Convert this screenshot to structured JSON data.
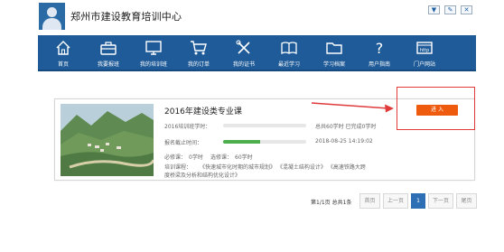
{
  "header": {
    "site_title": "郑州市建设教育培训中心",
    "btn1": "▼",
    "btn2": "✎",
    "btn3": "✕"
  },
  "nav": {
    "items": [
      {
        "label": "首页",
        "icon": "home-icon"
      },
      {
        "label": "我要报班",
        "icon": "briefcase-icon"
      },
      {
        "label": "我的培训班",
        "icon": "monitor-icon"
      },
      {
        "label": "我的订单",
        "icon": "cart-icon"
      },
      {
        "label": "我的证书",
        "icon": "tools-icon"
      },
      {
        "label": "最近学习",
        "icon": "book-icon"
      },
      {
        "label": "学习档案",
        "icon": "folder-icon"
      },
      {
        "label": "用户指南",
        "icon": "question-icon"
      },
      {
        "label": "门户网站",
        "icon": "web-icon"
      }
    ]
  },
  "course": {
    "title": "2016年建设类专业课",
    "study_label": "2016培训班学时：",
    "study_progress_text": "总共60学时 已完成0学时",
    "study_progress": 0,
    "deadline_label": "报名截止时间：",
    "deadline_value": "2018-08-25 14:19:02",
    "deadline_progress": 0.45,
    "required_label": "必修课：",
    "required_value": "0学时",
    "elective_label": "选修课：",
    "elective_value": "60学时",
    "courses_label": "培训课程：",
    "courses_line1": "《快速城市化时期的城市规划》 《混凝土结构设计》 《高速铁路大跨",
    "courses_line2": "度桥梁及分析和结构优化设计》",
    "enter_label": "进 入"
  },
  "pagination": {
    "info": "第1/1页 总共1条",
    "first": "首页",
    "prev": "上一页",
    "current": "1",
    "next": "下一页",
    "last": "尾页"
  },
  "colors": {
    "nav_bg": "#1f5b98",
    "enter_btn": "#ee5a0e",
    "highlight_box": "#e03a3a",
    "progress_green": "#4cae4c",
    "page_active": "#2d6fb4"
  }
}
